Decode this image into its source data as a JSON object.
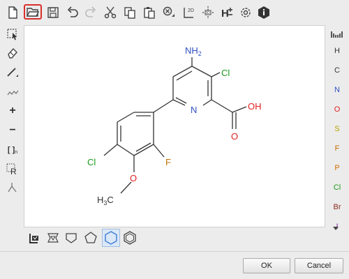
{
  "toolbar": {
    "items": [
      "new-file-icon",
      "open-file-icon",
      "save-icon",
      "undo-icon",
      "redo-icon",
      "cut-icon",
      "copy-icon",
      "paste-icon",
      "zoom-icon",
      "clean-2d-icon",
      "clean-3d-icon",
      "explicit-hydrogens-icon",
      "settings-icon",
      "info-icon"
    ],
    "h_label": "H",
    "label_2d": "2D",
    "label_3d": "3D"
  },
  "left_tools": {
    "items": [
      "select-tool-icon",
      "eraser-tool-icon",
      "bond-tool-icon",
      "chain-tool-icon",
      "charge-plus-icon",
      "charge-minus-icon",
      "sgroup-tool-icon",
      "rgroup-tool-icon",
      "reaction-tool-icon"
    ],
    "plus": "+",
    "minus": "−",
    "sgroup": "[ ]",
    "sgroup_sub": "n",
    "rgroup": "R"
  },
  "elements": [
    {
      "symbol": "H",
      "color": "#333333"
    },
    {
      "symbol": "C",
      "color": "#333333"
    },
    {
      "symbol": "N",
      "color": "#3050c0"
    },
    {
      "symbol": "O",
      "color": "#e02020"
    },
    {
      "symbol": "S",
      "color": "#b8a000"
    },
    {
      "symbol": "F",
      "color": "#c07000"
    },
    {
      "symbol": "P",
      "color": "#d07000"
    },
    {
      "symbol": "Cl",
      "color": "#1a9a1a"
    },
    {
      "symbol": "Br",
      "color": "#8a2a20"
    },
    {
      "symbol": "I",
      "color": "#8020a0"
    }
  ],
  "molecule": {
    "nh2_N": "N",
    "nh2_H": "H",
    "nh2_sub": "2",
    "cl_top": "Cl",
    "cl_left": "Cl",
    "n_ring": "N",
    "oh": "OH",
    "o_carbonyl": "O",
    "f": "F",
    "o_methoxy": "O",
    "h3c_H": "H",
    "h3c_sub": "3",
    "h3c_C": "C"
  },
  "templates": [
    "template-library-icon",
    "cyclopropane-template-icon",
    "cyclobutane-template-icon",
    "cyclopentane-template-icon",
    "cyclohexane-template-icon",
    "benzene-template-icon"
  ],
  "buttons": {
    "ok": "OK",
    "cancel": "Cancel"
  },
  "colors": {
    "selection": "#d9302a",
    "bond": "#333333",
    "nitrogen": "#3050c0",
    "oxygen": "#e02020",
    "chlorine": "#1a9a1a",
    "fluorine": "#c07000"
  }
}
